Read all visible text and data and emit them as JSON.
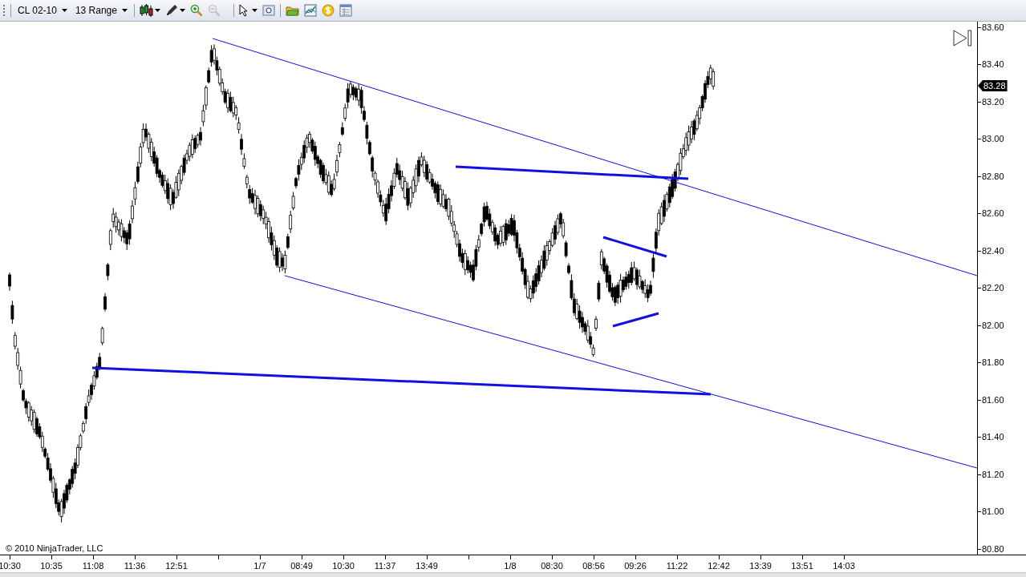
{
  "toolbar": {
    "instrument": "CL 02-10",
    "interval": "13 Range",
    "zoom_out_disabled": true
  },
  "chart": {
    "copyright": "© 2010 NinjaTrader, LLC",
    "current_price": "83.28"
  },
  "price_axis": [
    "83.60",
    "83.40",
    "83.20",
    "83.00",
    "82.80",
    "82.60",
    "82.40",
    "82.20",
    "82.00",
    "81.80",
    "81.60",
    "81.40",
    "81.20",
    "81.00",
    "80.80"
  ],
  "time_axis": [
    {
      "kind": "label",
      "label": "10:30"
    },
    {
      "kind": "label",
      "label": "10:35"
    },
    {
      "kind": "label",
      "label": "11:08"
    },
    {
      "kind": "label",
      "label": "11:36"
    },
    {
      "kind": "label",
      "label": "12:51"
    },
    {
      "kind": "blank"
    },
    {
      "kind": "label",
      "label": "1/7"
    },
    {
      "kind": "label",
      "label": "08:49"
    },
    {
      "kind": "label",
      "label": "10:30"
    },
    {
      "kind": "label",
      "label": "11:37"
    },
    {
      "kind": "label",
      "label": "13:49"
    },
    {
      "kind": "blank"
    },
    {
      "kind": "label",
      "label": "1/8"
    },
    {
      "kind": "label",
      "label": "08:30"
    },
    {
      "kind": "label",
      "label": "08:56"
    },
    {
      "kind": "label",
      "label": "09:26"
    },
    {
      "kind": "label",
      "label": "11:22"
    },
    {
      "kind": "label",
      "label": "12:42"
    },
    {
      "kind": "label",
      "label": "13:39"
    },
    {
      "kind": "label",
      "label": "13:51"
    },
    {
      "kind": "label",
      "label": "14:03"
    }
  ]
}
